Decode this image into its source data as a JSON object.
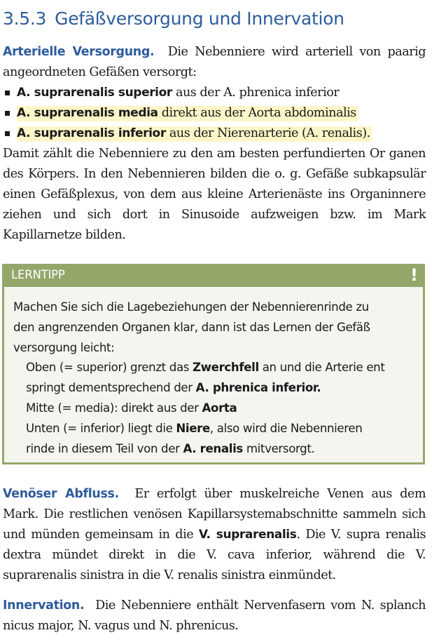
{
  "section": {
    "number": "3.5.3",
    "title": "Gefäßversorgung und Innervation"
  },
  "arterial": {
    "label": "Arterielle Versorgung.",
    "intro": "Die Nebenniere wird arteriell von paarig angeordneten Gefäßen versorgt:",
    "items": [
      {
        "term": "A. suprarenalis superior",
        "text": "aus der A. phrenica inferior"
      },
      {
        "term": "A. suprarenalis media",
        "text": "direkt aus der Aorta abdominalis"
      },
      {
        "term": "A. suprarenalis inferior",
        "text": "aus der Nierenarterie (A. renalis)."
      }
    ],
    "outro": "Damit zählt die Nebenniere zu den am besten perfundierten Or ganen des Körpers. In den Nebennieren bilden die o. g. Gefäße subkapsulär einen Gefäßplexus, von dem aus kleine Arterienäste ins Organinnere ziehen und sich dort in Sinusoide aufzweigen bzw. im Mark Kapillarnetze bilden."
  },
  "tip": {
    "title": "LERNTIPP",
    "icon": "exclamation-icon",
    "icon_glyph": "!",
    "intro_lines": [
      "Machen Sie sich die Lagebeziehungen der Nebennierenrinde zu",
      "den angrenzenden Organen klar, dann ist das Lernen der Gefäß",
      "versorgung leicht:"
    ],
    "superior": {
      "line1_pre": "Oben (= superior) grenzt das ",
      "line1_bold": "Zwerchfell",
      "line1_post": " an und die Arterie ent",
      "line2_pre": "springt dementsprechend der ",
      "line2_bold": "A. phrenica inferior."
    },
    "media": {
      "pre": "Mitte (= media): direkt aus der ",
      "bold": "Aorta"
    },
    "inferior": {
      "line1_pre": "Unten (= inferior) liegt die ",
      "line1_bold": "Niere",
      "line1_post": ", also wird die Nebennieren",
      "line2_pre": "rinde in diesem Teil von der ",
      "line2_bold": "A. renalis",
      "line2_post": " mitversorgt."
    }
  },
  "venous": {
    "label": "Venöser Abfluss.",
    "text_pre": "Er erfolgt über muskelreiche Venen aus dem Mark. Die restlichen venösen Kapillarsystemabschnitte sammeln sich und münden gemeinsam in die ",
    "bold": "V. suprarenalis",
    "text_post": ". Die V. supra renalis dextra mündet direkt in die V. cava inferior, während die V. suprarenalis sinistra in die V. renalis sinistra einmündet."
  },
  "innervation": {
    "label": "Innervation.",
    "text": "Die Nebenniere enthält Nervenfasern vom N. splanch nicus major, N. vagus und N. phrenicus."
  },
  "colors": {
    "accent": "#2e5c9c",
    "tip_border": "#94a76a",
    "tip_background": "#f4f5ef",
    "highlight": "#fdf6c8"
  }
}
